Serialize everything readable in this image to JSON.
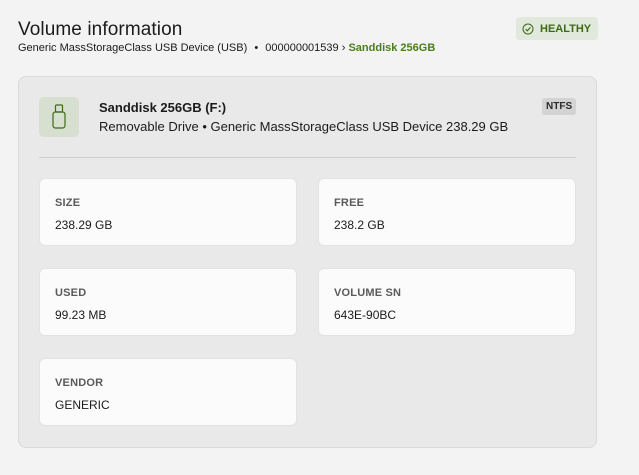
{
  "header": {
    "title": "Volume information",
    "breadcrumb": {
      "device": "Generic MassStorageClass USB Device (USB)",
      "bullet": "•",
      "serial": "000000001539",
      "chevron": "›",
      "current": "Sanddisk 256GB"
    },
    "status": {
      "label": "HEALTHY",
      "icon": "check-circle-icon"
    }
  },
  "volume": {
    "icon": "usb-drive-icon",
    "name": "Sanddisk 256GB (F:)",
    "description": "Removable Drive • Generic MassStorageClass USB Device 238.29 GB",
    "filesystem": "NTFS"
  },
  "stats": {
    "size": {
      "label": "SIZE",
      "value": "238.29 GB"
    },
    "free": {
      "label": "FREE",
      "value": "238.2 GB"
    },
    "used": {
      "label": "USED",
      "value": "99.23 MB"
    },
    "volume_sn": {
      "label": "VOLUME SN",
      "value": "643E-90BC"
    },
    "vendor": {
      "label": "VENDOR",
      "value": "GENERIC"
    }
  },
  "colors": {
    "accent_green": "#4a7d1a",
    "badge_bg": "#e1e8dc",
    "card_bg": "#e9e9e9",
    "tile_bg": "#fbfbfb"
  }
}
